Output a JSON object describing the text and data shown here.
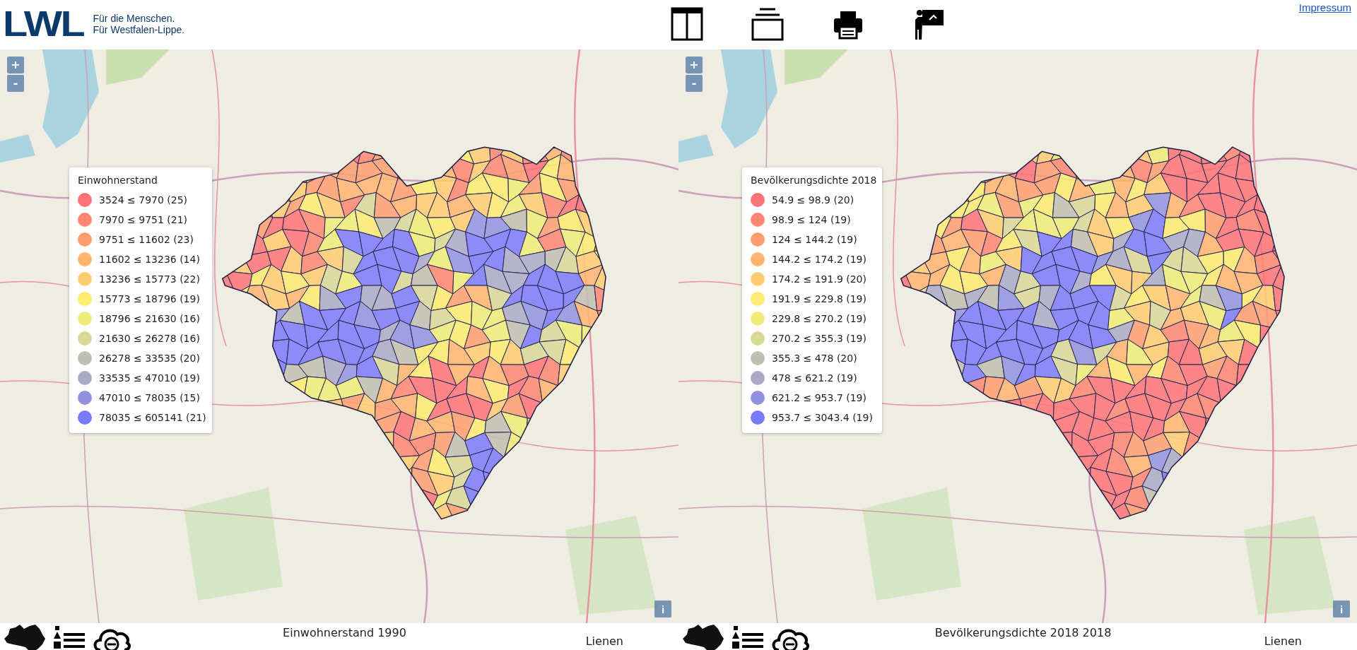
{
  "header": {
    "logo": "LWL",
    "tagline": [
      "Für die Menschen.",
      "Für Westfalen-Lippe."
    ],
    "link": "Impressum"
  },
  "maps": [
    {
      "zoom": {
        "in": "+",
        "out": "-"
      },
      "info": "i",
      "legend": {
        "title": "Einwohnerstand",
        "items": [
          {
            "label": "3524 ≤ 7970 (25)",
            "color": "#ff7378"
          },
          {
            "label": "7970 ≤ 9751 (21)",
            "color": "#ff8672"
          },
          {
            "label": "9751 ≤ 11602 (23)",
            "color": "#ff9d70"
          },
          {
            "label": "11602 ≤ 13236 (14)",
            "color": "#ffb570"
          },
          {
            "label": "13236 ≤ 15773 (22)",
            "color": "#ffcd70"
          },
          {
            "label": "15773 ≤ 18796 (19)",
            "color": "#fcec70"
          },
          {
            "label": "18796 ≤ 21630 (16)",
            "color": "#f0ec78"
          },
          {
            "label": "21630 ≤ 26278 (16)",
            "color": "#d8d898"
          },
          {
            "label": "26278 ≤ 33535 (20)",
            "color": "#c0c0b2"
          },
          {
            "label": "33535 ≤ 47010 (19)",
            "color": "#aaaac8"
          },
          {
            "label": "47010 ≤ 78035 (15)",
            "color": "#9292e0"
          },
          {
            "label": "78035 ≤ 605141 (21)",
            "color": "#7a7afc"
          }
        ]
      },
      "footer": {
        "title": "Einwohnerstand 1990",
        "place": "Lienen"
      }
    },
    {
      "zoom": {
        "in": "+",
        "out": "-"
      },
      "info": "i",
      "legend": {
        "title": "Bevölkerungsdichte 2018",
        "items": [
          {
            "label": "54.9 ≤ 98.9 (20)",
            "color": "#ff7378"
          },
          {
            "label": "98.9 ≤ 124 (19)",
            "color": "#ff8672"
          },
          {
            "label": "124 ≤ 144.2 (19)",
            "color": "#ff9d70"
          },
          {
            "label": "144.2 ≤ 174.2 (19)",
            "color": "#ffb570"
          },
          {
            "label": "174.2 ≤ 191.9 (20)",
            "color": "#ffcd70"
          },
          {
            "label": "191.9 ≤ 229.8 (19)",
            "color": "#fcec70"
          },
          {
            "label": "229.8 ≤ 270.2 (19)",
            "color": "#f0ec78"
          },
          {
            "label": "270.2 ≤ 355.3 (19)",
            "color": "#d8d898"
          },
          {
            "label": "355.3 ≤ 478 (20)",
            "color": "#c0c0b2"
          },
          {
            "label": "478 ≤ 621.2 (19)",
            "color": "#aaaac8"
          },
          {
            "label": "621.2 ≤ 953.7 (19)",
            "color": "#9292e0"
          },
          {
            "label": "953.7 ≤ 3043.4 (19)",
            "color": "#7a7afc"
          }
        ]
      },
      "footer": {
        "title": "Bevölkerungsdichte 2018 2018",
        "place": "Lienen"
      }
    }
  ]
}
